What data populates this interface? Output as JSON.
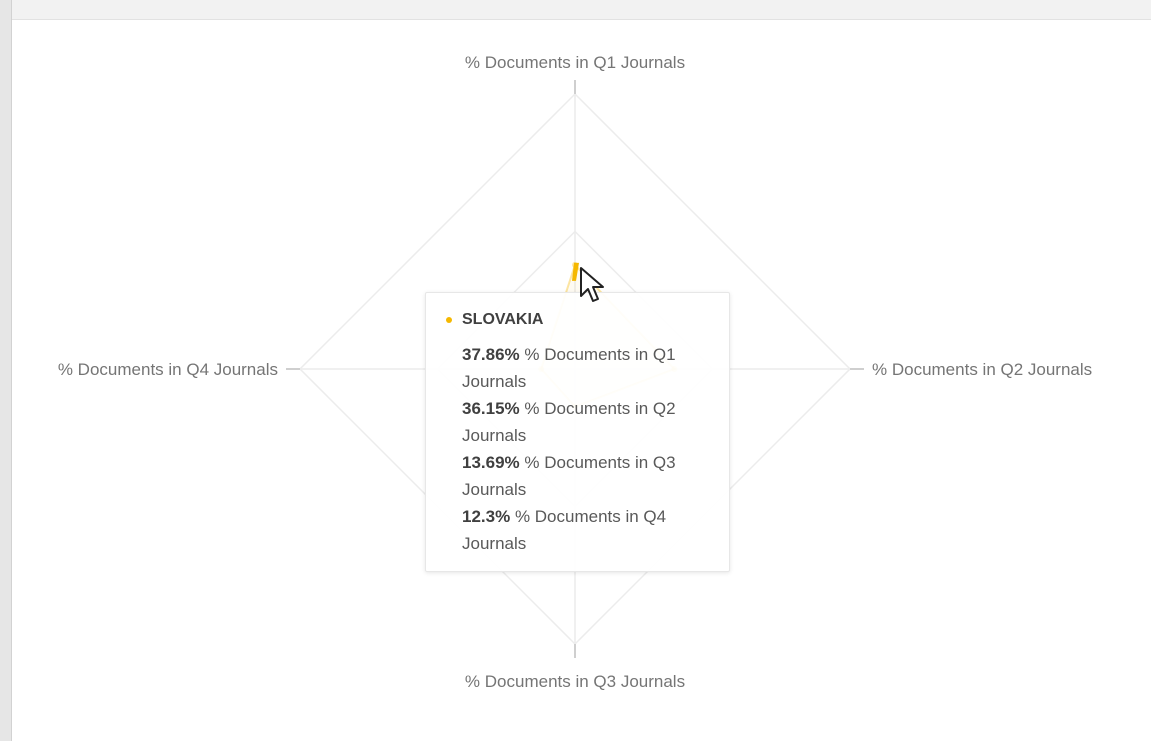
{
  "chart_data": {
    "type": "radar",
    "axes": [
      "% Documents in Q1 Journals",
      "% Documents in Q2 Journals",
      "% Documents in Q3 Journals",
      "% Documents in Q4 Journals"
    ],
    "series": [
      {
        "name": "SLOVAKIA",
        "color": "#f5b800",
        "values": [
          37.86,
          36.15,
          13.69,
          12.3
        ]
      }
    ],
    "rmax": 100,
    "grid_levels": [
      50,
      100
    ]
  },
  "tooltip": {
    "title": "SLOVAKIA",
    "rows": [
      {
        "value": "37.86%",
        "label": "% Documents in Q1 Journals"
      },
      {
        "value": "36.15%",
        "label": "% Documents in Q2 Journals"
      },
      {
        "value": "13.69%",
        "label": "% Documents in Q3 Journals"
      },
      {
        "value": "12.3%",
        "label": "% Documents in Q4 Journals"
      }
    ]
  }
}
